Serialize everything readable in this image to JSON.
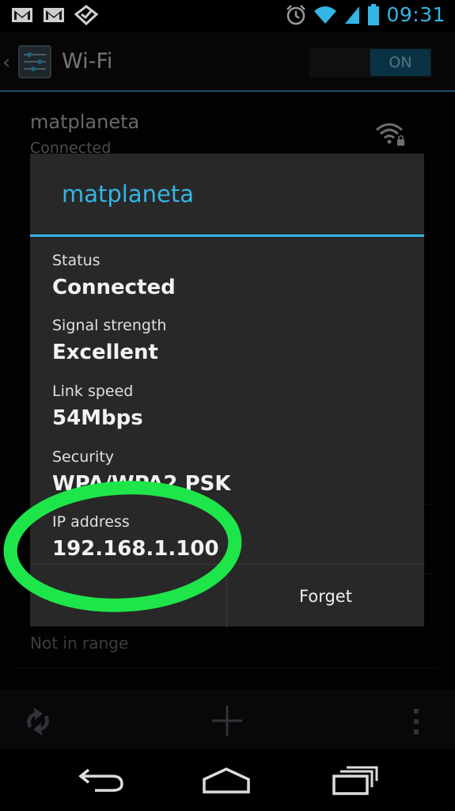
{
  "status_bar": {
    "time": "09:31",
    "icons": [
      "gmail-icon",
      "gmail-icon",
      "checklist-icon",
      "alarm-icon",
      "wifi-icon",
      "signal-icon",
      "battery-icon"
    ]
  },
  "action_bar": {
    "title": "Wi-Fi",
    "toggle_label": "ON"
  },
  "network_list": {
    "current_network": "matplaneta",
    "current_status": "Connected",
    "other_status": "Not in range"
  },
  "dialog": {
    "title": "matplaneta",
    "fields": [
      {
        "label": "Status",
        "value": "Connected"
      },
      {
        "label": "Signal strength",
        "value": "Excellent"
      },
      {
        "label": "Link speed",
        "value": "54Mbps"
      },
      {
        "label": "Security",
        "value": "WPA/WPA2 PSK"
      },
      {
        "label": "IP address",
        "value": "192.168.1.100"
      }
    ],
    "forget_label": "Forget"
  },
  "colors": {
    "accent": "#33b5e5",
    "annotation": "#1ee64a",
    "dialog_bg": "#282828"
  }
}
